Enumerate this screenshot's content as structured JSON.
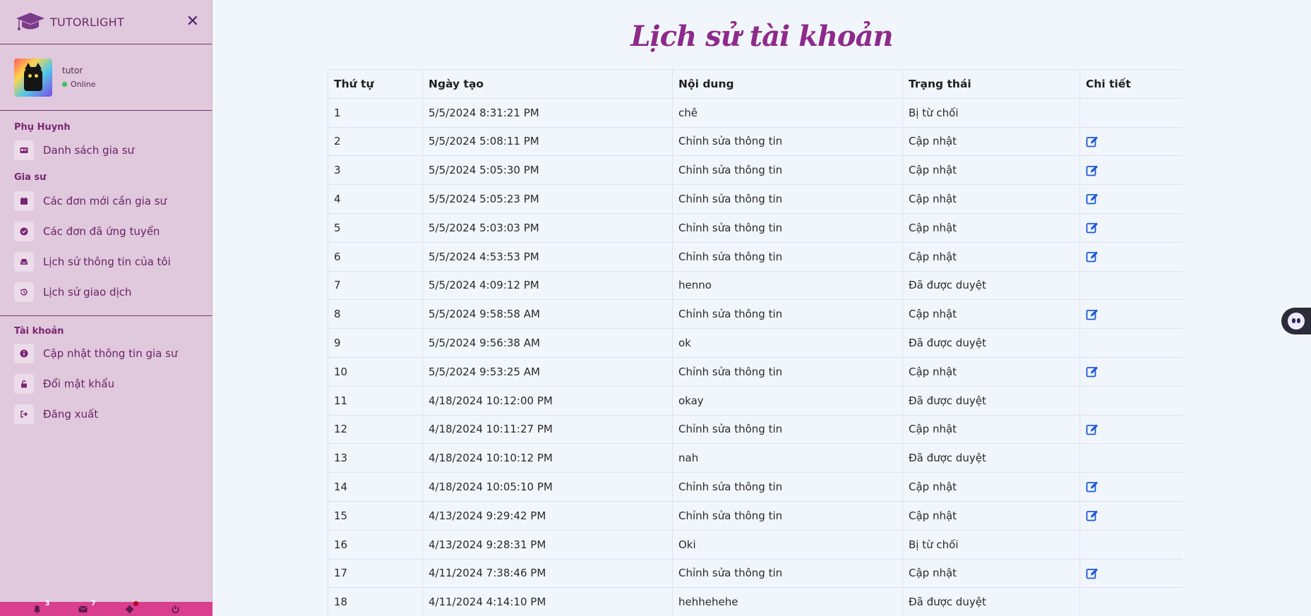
{
  "brand": {
    "name": "TUTORLIGHT"
  },
  "profile": {
    "username": "tutor",
    "status": "Online"
  },
  "sections": [
    {
      "title": "Phụ Huynh",
      "items": [
        {
          "label": "Danh sách gia sư",
          "icon": "id-card-icon"
        }
      ]
    },
    {
      "title": "Gia sư",
      "items": [
        {
          "label": "Các đơn mới cần gia sư",
          "icon": "calendar-icon"
        },
        {
          "label": "Các đơn đã ứng tuyển",
          "icon": "check-circle-icon"
        },
        {
          "label": "Lịch sử thông tin của tôi",
          "icon": "inbox-icon"
        },
        {
          "label": "Lịch sử giao dịch",
          "icon": "history-icon"
        }
      ]
    },
    {
      "title": "Tài khoản",
      "items": [
        {
          "label": "Cập nhật thông tin gia sư",
          "icon": "info-icon"
        },
        {
          "label": "Đổi mật khẩu",
          "icon": "unlock-icon"
        },
        {
          "label": "Đăng xuất",
          "icon": "sign-out-icon"
        }
      ]
    }
  ],
  "bottom_bar": {
    "notifications": "3",
    "messages": "7"
  },
  "page_title": "Lịch sử tài khoản",
  "table": {
    "headers": [
      "Thứ tự",
      "Ngày tạo",
      "Nội dung",
      "Trạng thái",
      "Chi tiết"
    ],
    "rows": [
      {
        "no": "1",
        "date": "5/5/2024 8:31:21 PM",
        "content": "chê",
        "status": "Bị từ chối",
        "edit": false
      },
      {
        "no": "2",
        "date": "5/5/2024 5:08:11 PM",
        "content": "Chỉnh sửa thông tin",
        "status": "Cập nhật",
        "edit": true
      },
      {
        "no": "3",
        "date": "5/5/2024 5:05:30 PM",
        "content": "Chỉnh sửa thông tin",
        "status": "Cập nhật",
        "edit": true
      },
      {
        "no": "4",
        "date": "5/5/2024 5:05:23 PM",
        "content": "Chỉnh sửa thông tin",
        "status": "Cập nhật",
        "edit": true
      },
      {
        "no": "5",
        "date": "5/5/2024 5:03:03 PM",
        "content": "Chỉnh sửa thông tin",
        "status": "Cập nhật",
        "edit": true
      },
      {
        "no": "6",
        "date": "5/5/2024 4:53:53 PM",
        "content": "Chỉnh sửa thông tin",
        "status": "Cập nhật",
        "edit": true
      },
      {
        "no": "7",
        "date": "5/5/2024 4:09:12 PM",
        "content": "henno",
        "status": "Đã được duyệt",
        "edit": false
      },
      {
        "no": "8",
        "date": "5/5/2024 9:58:58 AM",
        "content": "Chỉnh sửa thông tin",
        "status": "Cập nhật",
        "edit": true
      },
      {
        "no": "9",
        "date": "5/5/2024 9:56:38 AM",
        "content": "ok",
        "status": "Đã được duyệt",
        "edit": false
      },
      {
        "no": "10",
        "date": "5/5/2024 9:53:25 AM",
        "content": "Chỉnh sửa thông tin",
        "status": "Cập nhật",
        "edit": true
      },
      {
        "no": "11",
        "date": "4/18/2024 10:12:00 PM",
        "content": "okay",
        "status": "Đã được duyệt",
        "edit": false
      },
      {
        "no": "12",
        "date": "4/18/2024 10:11:27 PM",
        "content": "Chỉnh sửa thông tin",
        "status": "Cập nhật",
        "edit": true
      },
      {
        "no": "13",
        "date": "4/18/2024 10:10:12 PM",
        "content": "nah",
        "status": "Đã được duyệt",
        "edit": false
      },
      {
        "no": "14",
        "date": "4/18/2024 10:05:10 PM",
        "content": "Chỉnh sửa thông tin",
        "status": "Cập nhật",
        "edit": true
      },
      {
        "no": "15",
        "date": "4/13/2024 9:29:42 PM",
        "content": "Chỉnh sửa thông tin",
        "status": "Cập nhật",
        "edit": true
      },
      {
        "no": "16",
        "date": "4/13/2024 9:28:31 PM",
        "content": "Oki",
        "status": "Bị từ chối",
        "edit": false
      },
      {
        "no": "17",
        "date": "4/11/2024 7:38:46 PM",
        "content": "Chỉnh sửa thông tin",
        "status": "Cập nhật",
        "edit": true
      },
      {
        "no": "18",
        "date": "4/11/2024 4:14:10 PM",
        "content": "hehhehehe",
        "status": "Đã được duyệt",
        "edit": false
      }
    ]
  }
}
